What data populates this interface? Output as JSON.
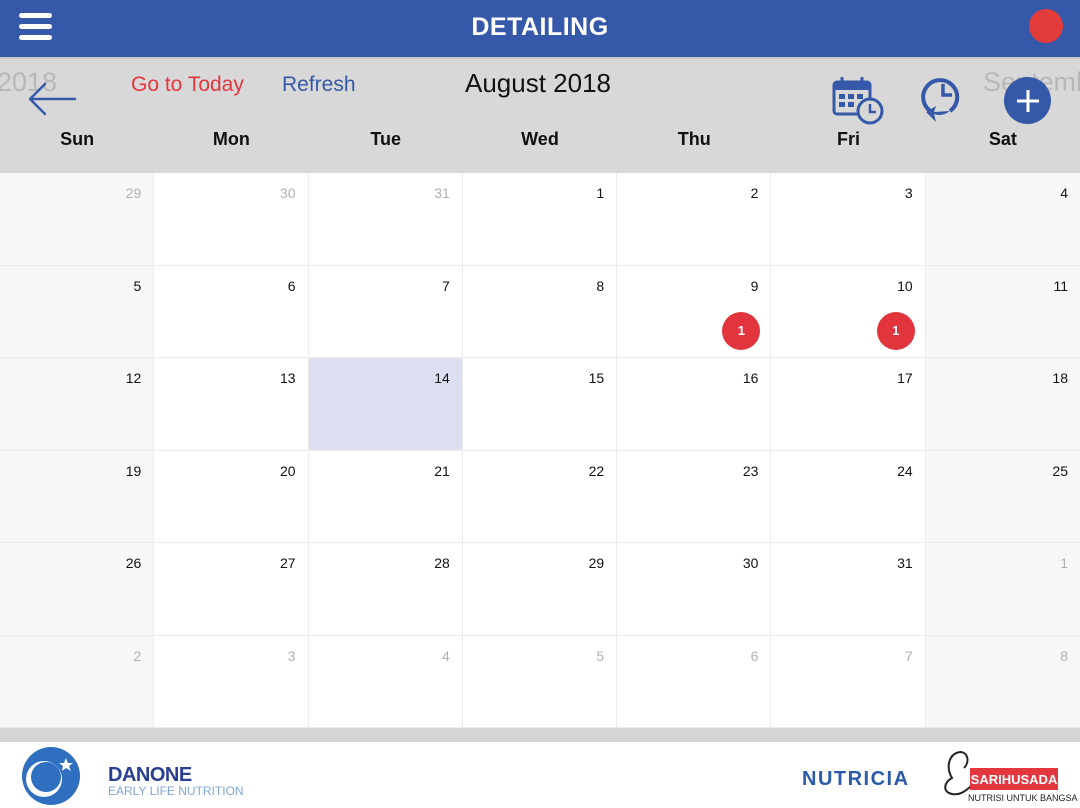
{
  "app": {
    "title": "DETAILING",
    "status_color": "#e33a3a",
    "brand_color": "#3658a8"
  },
  "header": {
    "prev_month_ghost": "2018",
    "next_month_ghost": "Septemb",
    "go_to_today_label": "Go to Today",
    "refresh_label": "Refresh",
    "month_title": "August 2018",
    "icons": [
      "back-arrow-icon",
      "calendar-clock-icon",
      "history-icon",
      "add-icon"
    ]
  },
  "weekdays": [
    "Sun",
    "Mon",
    "Tue",
    "Wed",
    "Thu",
    "Fri",
    "Sat"
  ],
  "calendar": {
    "today": 14,
    "weeks": [
      [
        {
          "d": "29",
          "other": true
        },
        {
          "d": "30",
          "other": true
        },
        {
          "d": "31",
          "other": true
        },
        {
          "d": "1"
        },
        {
          "d": "2"
        },
        {
          "d": "3"
        },
        {
          "d": "4"
        }
      ],
      [
        {
          "d": "5"
        },
        {
          "d": "6"
        },
        {
          "d": "7"
        },
        {
          "d": "8"
        },
        {
          "d": "9",
          "badge": "1"
        },
        {
          "d": "10",
          "badge": "1"
        },
        {
          "d": "11"
        }
      ],
      [
        {
          "d": "12"
        },
        {
          "d": "13"
        },
        {
          "d": "14",
          "today": true
        },
        {
          "d": "15"
        },
        {
          "d": "16"
        },
        {
          "d": "17"
        },
        {
          "d": "18"
        }
      ],
      [
        {
          "d": "19"
        },
        {
          "d": "20"
        },
        {
          "d": "21"
        },
        {
          "d": "22"
        },
        {
          "d": "23"
        },
        {
          "d": "24"
        },
        {
          "d": "25"
        }
      ],
      [
        {
          "d": "26"
        },
        {
          "d": "27"
        },
        {
          "d": "28"
        },
        {
          "d": "29"
        },
        {
          "d": "30"
        },
        {
          "d": "31"
        },
        {
          "d": "1",
          "other": true
        }
      ],
      [
        {
          "d": "2",
          "other": true
        },
        {
          "d": "3",
          "other": true
        },
        {
          "d": "4",
          "other": true
        },
        {
          "d": "5",
          "other": true
        },
        {
          "d": "6",
          "other": true
        },
        {
          "d": "7",
          "other": true
        },
        {
          "d": "8",
          "other": true
        }
      ]
    ]
  },
  "footer": {
    "danone_name": "DANONE",
    "danone_sub": "EARLY LIFE NUTRITION",
    "nutricia": "NUTRICIA",
    "sarihusada": "SARIHUSADA",
    "sarihusada_sub": "NUTRISI UNTUK BANGSA"
  }
}
